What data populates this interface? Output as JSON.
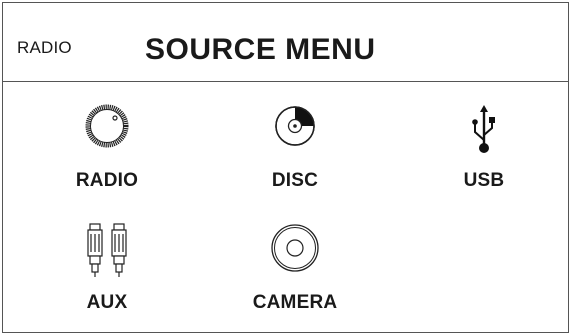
{
  "header": {
    "current_source": "RADIO",
    "title": "SOURCE MENU"
  },
  "sources": [
    {
      "label": "RADIO",
      "icon": "radio-knob-icon"
    },
    {
      "label": "DISC",
      "icon": "disc-icon"
    },
    {
      "label": "USB",
      "icon": "usb-icon"
    },
    {
      "label": "AUX",
      "icon": "aux-cable-icon"
    },
    {
      "label": "CAMERA",
      "icon": "camera-lens-icon"
    }
  ]
}
